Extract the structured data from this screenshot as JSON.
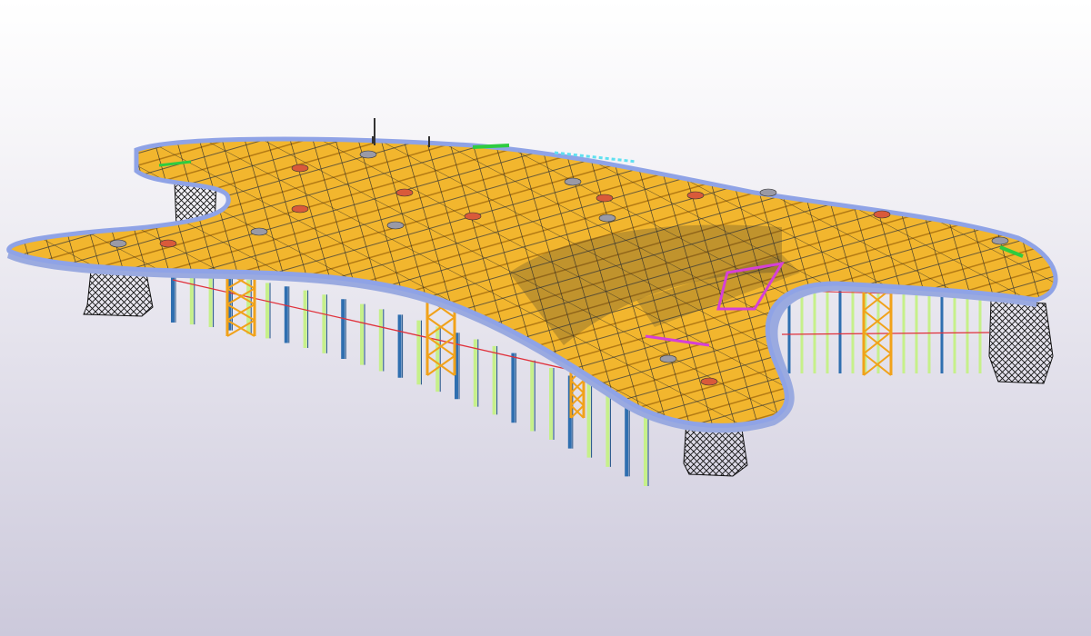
{
  "viewport": {
    "background_top": "#ffffff",
    "background_bottom": "#ccc9db"
  },
  "model": {
    "roof_color": "#f2b62e",
    "roof_shadow_color": "#c98a1c",
    "edge_beam_color": "#8fa3e6",
    "column_color": "#2f6fb0",
    "column_light_color": "#c6f08a",
    "bracing_color": "#f1a21a",
    "support_tower_color": "#1a1a1a",
    "tension_cable_color": "#e0303a",
    "accent_magenta": "#d640d6",
    "accent_green": "#2ecc40",
    "accent_cyan": "#5fe0f0",
    "panel_color": "#d95a3a"
  }
}
